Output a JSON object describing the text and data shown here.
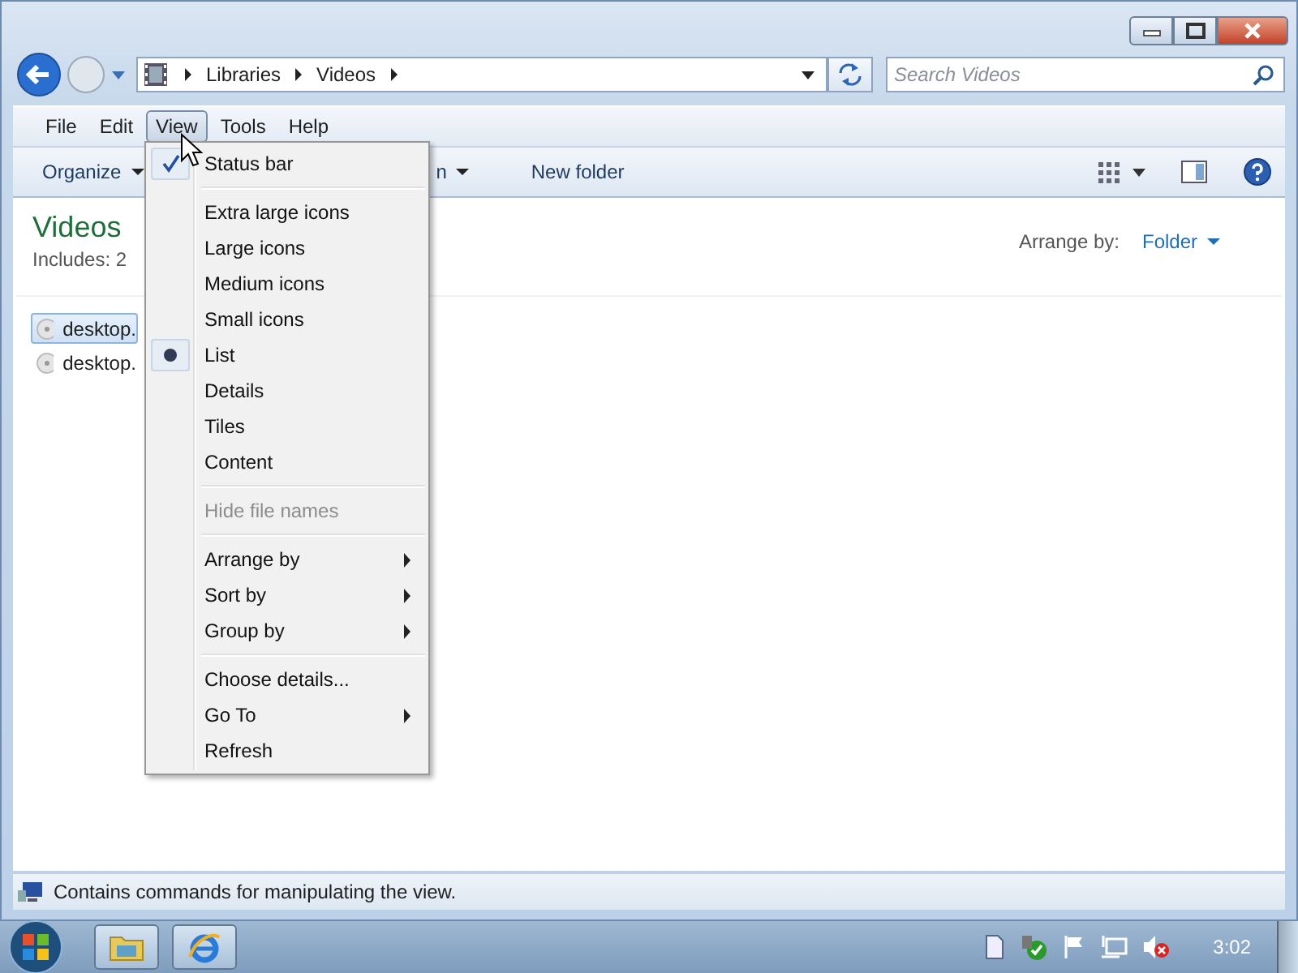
{
  "address": {
    "path": [
      "Libraries",
      "Videos"
    ]
  },
  "search": {
    "placeholder": "Search Videos"
  },
  "menubar": [
    {
      "label": "File",
      "selected": false
    },
    {
      "label": "Edit",
      "selected": false
    },
    {
      "label": "View",
      "selected": true
    },
    {
      "label": "Tools",
      "selected": false
    },
    {
      "label": "Help",
      "selected": false
    }
  ],
  "toolbar": [
    {
      "label": "Organize",
      "dropdown": true
    },
    {
      "label": "n",
      "dropdown": true
    },
    {
      "label": "New folder",
      "dropdown": false
    }
  ],
  "library": {
    "title": "Videos",
    "includes": "Includes: 2",
    "arrange_label": "Arrange by:",
    "arrange_value": "Folder"
  },
  "files": [
    {
      "name": "desktop.",
      "selected": true
    },
    {
      "name": "desktop.",
      "selected": false
    }
  ],
  "menu": [
    {
      "kind": "check",
      "label": "Status bar",
      "checked": true
    },
    {
      "kind": "separator"
    },
    {
      "kind": "radio",
      "label": "Extra large icons",
      "selected": false
    },
    {
      "kind": "radio",
      "label": "Large icons",
      "selected": false
    },
    {
      "kind": "radio",
      "label": "Medium icons",
      "selected": false
    },
    {
      "kind": "radio",
      "label": "Small icons",
      "selected": false
    },
    {
      "kind": "radio",
      "label": "List",
      "selected": true
    },
    {
      "kind": "radio",
      "label": "Details",
      "selected": false
    },
    {
      "kind": "radio",
      "label": "Tiles",
      "selected": false
    },
    {
      "kind": "radio",
      "label": "Content",
      "selected": false
    },
    {
      "kind": "separator"
    },
    {
      "kind": "command",
      "label": "Hide file names",
      "disabled": true
    },
    {
      "kind": "separator"
    },
    {
      "kind": "submenu",
      "label": "Arrange by"
    },
    {
      "kind": "submenu",
      "label": "Sort by"
    },
    {
      "kind": "submenu",
      "label": "Group by"
    },
    {
      "kind": "separator"
    },
    {
      "kind": "command",
      "label": "Choose details...",
      "disabled": false
    },
    {
      "kind": "submenu",
      "label": "Go To"
    },
    {
      "kind": "command",
      "label": "Refresh",
      "disabled": false
    }
  ],
  "status_bar": {
    "text": "Contains commands for manipulating the view."
  },
  "taskbar": {
    "clock": "3:02"
  }
}
